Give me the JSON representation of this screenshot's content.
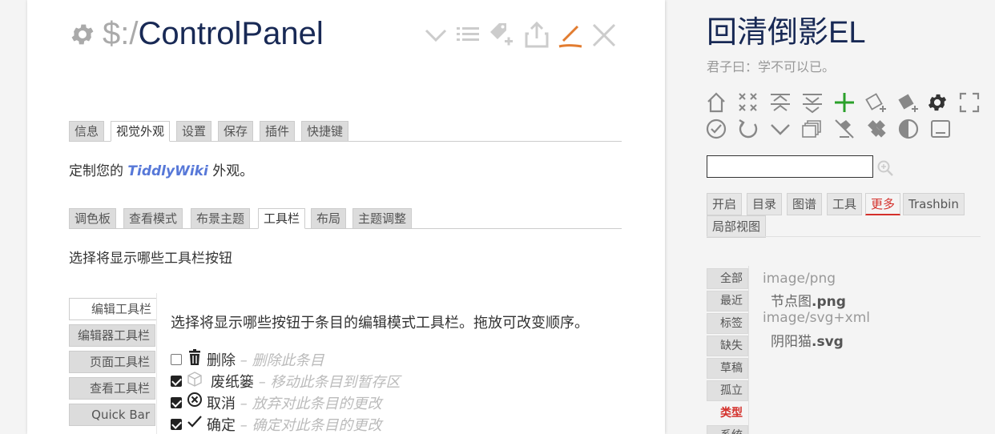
{
  "tiddler": {
    "title_prefix": "$:/",
    "title_main": "ControlPanel",
    "controls": [
      "chevron-down-icon",
      "list-icon",
      "tag-add-icon",
      "export-icon",
      "edit-pencil-icon",
      "close-icon"
    ],
    "accent_color": "#e27c30",
    "top_tabs": [
      "信息",
      "视觉外观",
      "设置",
      "保存",
      "插件",
      "快捷键"
    ],
    "top_active": "视觉外观",
    "appearance_desc_before": "定制您的 ",
    "appearance_desc_link": "TiddlyWiki",
    "appearance_desc_after": " 外观。",
    "sub_tabs": [
      "调色板",
      "查看模式",
      "布景主题",
      "工具栏",
      "布局",
      "主题调整"
    ],
    "sub_active": "工具栏",
    "toolbar_desc": "选择将显示哪些工具栏按钮",
    "vertical_tabs": [
      "编辑工具栏",
      "编辑器工具栏",
      "页面工具栏",
      "查看工具栏",
      "Quick Bar"
    ],
    "vertical_active": "编辑工具栏",
    "edit_toolbar_desc": "选择将显示哪些按钮于条目的编辑模式工具栏。拖放可改变顺序。",
    "toolbar_items": [
      {
        "checked": false,
        "icon": "trash-icon",
        "label": "删除",
        "hint": "– 删除此条目"
      },
      {
        "checked": true,
        "icon": "cube-icon",
        "label": "废纸篓",
        "hint": "– 移动此条目到暂存区"
      },
      {
        "checked": true,
        "icon": "cancel-circle-icon",
        "label": "取消",
        "hint": "– 放弃对此条目的更改"
      },
      {
        "checked": true,
        "icon": "checkmark-icon",
        "label": "确定",
        "hint": "– 确定对此条目的更改"
      }
    ]
  },
  "sidebar": {
    "site_title": "回清倒影EL",
    "site_subtitle": "君子曰：学不可以已。",
    "page_controls_row1": [
      "home-icon",
      "close-all-icon",
      "fold-all-icon",
      "unfold-all-icon",
      "new-tiddler-icon",
      "new-journal-icon",
      "new-image-icon",
      "control-panel-icon",
      "fullscreen-icon"
    ],
    "page_controls_row2": [
      "save-wiki-icon",
      "refresh-icon",
      "more-chevron-icon",
      "layers-icon",
      "no-tag-icon",
      "palette-icon",
      "contrast-icon",
      "layout-icon"
    ],
    "green_color": "#2aa02a",
    "search_value": "",
    "tabs": [
      "开启",
      "目录",
      "图谱",
      "工具",
      "更多",
      "Trashbin",
      "局部视图"
    ],
    "tab_active": "更多",
    "more_tabs": [
      "全部",
      "最近",
      "标签",
      "缺失",
      "草稿",
      "孤立",
      "类型",
      "系统"
    ],
    "more_active": "类型",
    "type_groups": [
      {
        "type": "image/png",
        "items": [
          {
            "name": "节点图",
            "ext": ".png"
          }
        ]
      },
      {
        "type": "image/svg+xml",
        "items": [
          {
            "name": "阴阳猫",
            "ext": ".svg"
          }
        ]
      }
    ]
  }
}
